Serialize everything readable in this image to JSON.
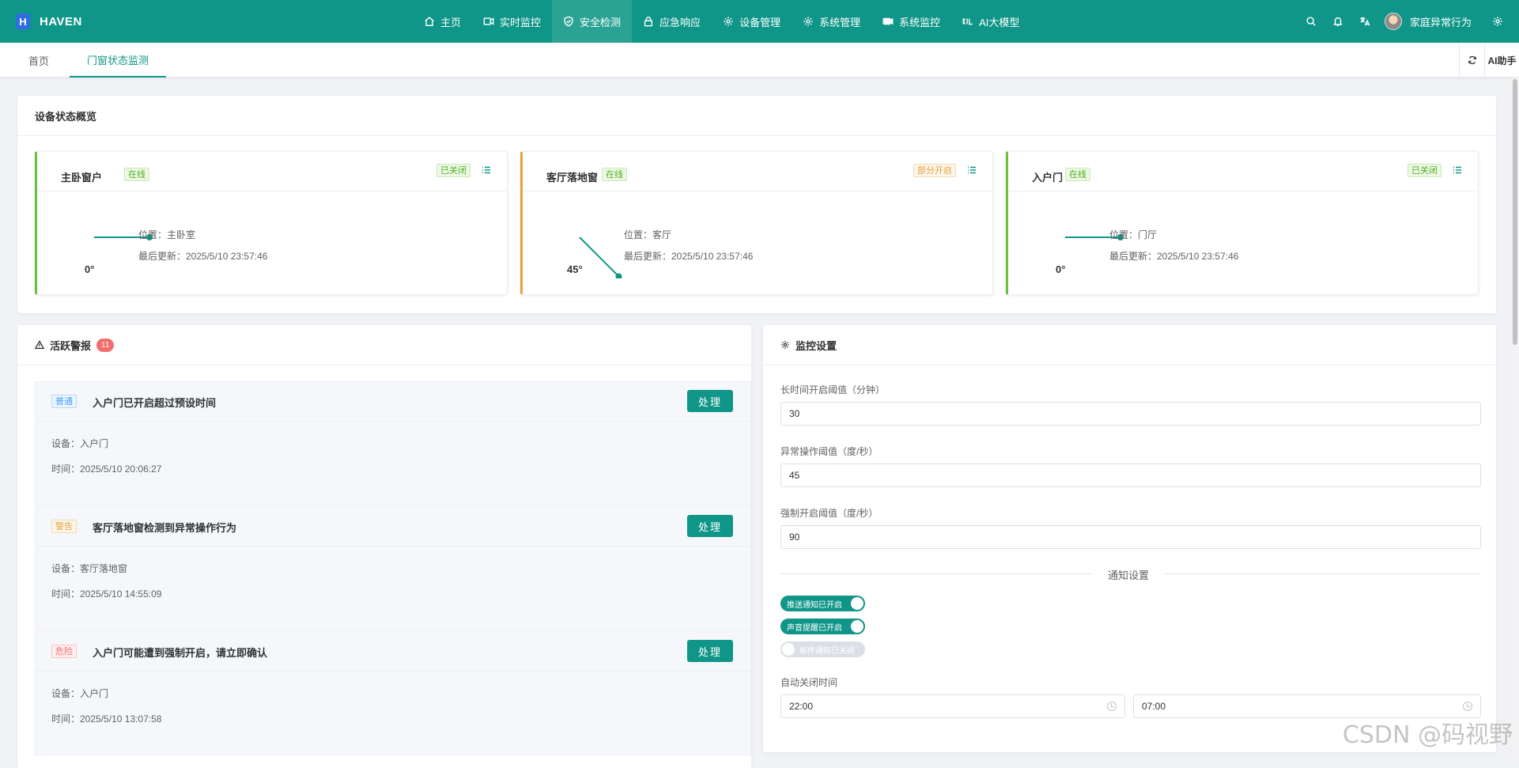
{
  "app": {
    "logo_letter": "H",
    "name": "HAVEN"
  },
  "nav": {
    "items": [
      {
        "label": "主页",
        "icon": "home-icon"
      },
      {
        "label": "实时监控",
        "icon": "video-icon"
      },
      {
        "label": "安全检测",
        "icon": "shield-check-icon",
        "active": true
      },
      {
        "label": "应急响应",
        "icon": "lock-icon"
      },
      {
        "label": "设备管理",
        "icon": "gear-icon"
      },
      {
        "label": "系统管理",
        "icon": "gear-icon"
      },
      {
        "label": "系统监控",
        "icon": "camera-icon"
      },
      {
        "label": "AI大模型",
        "icon": "ai-icon"
      }
    ],
    "user_name": "家庭异常行为"
  },
  "tabs": [
    {
      "label": "首页"
    },
    {
      "label": "门窗状态监测",
      "active": true
    }
  ],
  "tab_tools": {
    "ai_label": "AI助手"
  },
  "overview": {
    "title": "设备状态概览",
    "devices": [
      {
        "name": "主卧窗户",
        "online": "在线",
        "status": "已关闭",
        "status_color": "green",
        "accent": "#67c23a",
        "angle": 0,
        "angle_label": "0°",
        "location": "位置：主卧室",
        "updated": "最后更新：2025/5/10 23:57:46"
      },
      {
        "name": "客厅落地窗",
        "online": "在线",
        "status": "部分开启",
        "status_color": "orange",
        "accent": "#e6a23c",
        "angle": 45,
        "angle_label": "45°",
        "location": "位置：客厅",
        "updated": "最后更新：2025/5/10 23:57:46"
      },
      {
        "name": "入户门",
        "online": "在线",
        "status": "已关闭",
        "status_color": "green",
        "accent": "#67c23a",
        "angle": 0,
        "angle_label": "0°",
        "location": "位置：门厅",
        "updated": "最后更新：2025/5/10 23:57:46"
      }
    ]
  },
  "alerts": {
    "title": "活跃警报",
    "count": "11",
    "items": [
      {
        "level": "普通",
        "level_color": "blue",
        "title": "入户门已开启超过预设时间",
        "device": "设备：入户门",
        "time": "时间：2025/5/10 20:06:27",
        "action": "处理"
      },
      {
        "level": "警告",
        "level_color": "orange",
        "title": "客厅落地窗检测到异常操作行为",
        "device": "设备：客厅落地窗",
        "time": "时间：2025/5/10 14:55:09",
        "action": "处理"
      },
      {
        "level": "危险",
        "level_color": "red",
        "title": "入户门可能遭到强制开启，请立即确认",
        "device": "设备：入户门",
        "time": "时间：2025/5/10 13:07:58",
        "action": "处理"
      }
    ]
  },
  "settings": {
    "title": "监控设置",
    "long_open_label": "长时间开启阈值（分钟）",
    "long_open_value": "30",
    "abnormal_label": "异常操作阈值（度/秒）",
    "abnormal_value": "45",
    "forced_label": "强制开启阈值（度/秒）",
    "forced_value": "90",
    "notify_title": "通知设置",
    "switches": [
      {
        "label": "推送通知已开启",
        "on": true
      },
      {
        "label": "声音提醒已开启",
        "on": true
      },
      {
        "label": "邮件通知已关闭",
        "on": false
      }
    ],
    "auto_close_label": "自动关闭时间",
    "start_time": "22:00",
    "end_time": "07:00"
  },
  "watermark": "CSDN @码视野"
}
